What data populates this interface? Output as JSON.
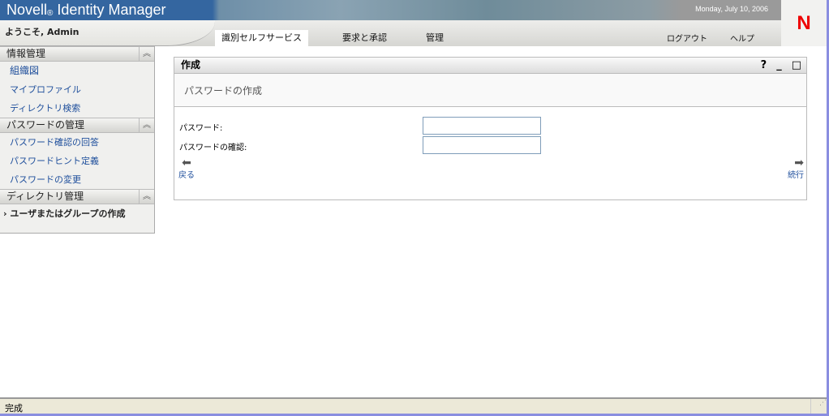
{
  "header": {
    "brand": "Novell",
    "registered": "®",
    "product": "Identity Manager",
    "date": "Monday, July 10, 2006",
    "logo": "N",
    "welcome": "ようこそ, Admin"
  },
  "tabs": [
    {
      "label": "識別セルフサービス",
      "active": true
    },
    {
      "label": "要求と承認"
    },
    {
      "label": "管理"
    }
  ],
  "toplinks": {
    "logout": "ログアウト",
    "help": "ヘルプ"
  },
  "sidebar": {
    "sections": [
      {
        "title": "情報管理",
        "items": [
          "組織図",
          "マイプロファイル",
          "ディレクトリ検索"
        ]
      },
      {
        "title": "パスワードの管理",
        "items": [
          "パスワード確認の回答",
          "パスワードヒント定義",
          "パスワードの変更"
        ]
      },
      {
        "title": "ディレクトリ管理",
        "items": [
          "ユーザまたはグループの作成"
        ]
      }
    ],
    "collapse_icon": "double-chevron-up-icon",
    "current_marker": "›"
  },
  "panel": {
    "title": "作成",
    "subtitle": "パスワードの作成",
    "help": "?",
    "minimize": "_",
    "maximize": "□",
    "fields": [
      {
        "label": "パスワード:",
        "value": ""
      },
      {
        "label": "パスワードの確認:",
        "value": ""
      }
    ],
    "back": "戻る",
    "next": "続行"
  },
  "status": {
    "text": "完成"
  }
}
